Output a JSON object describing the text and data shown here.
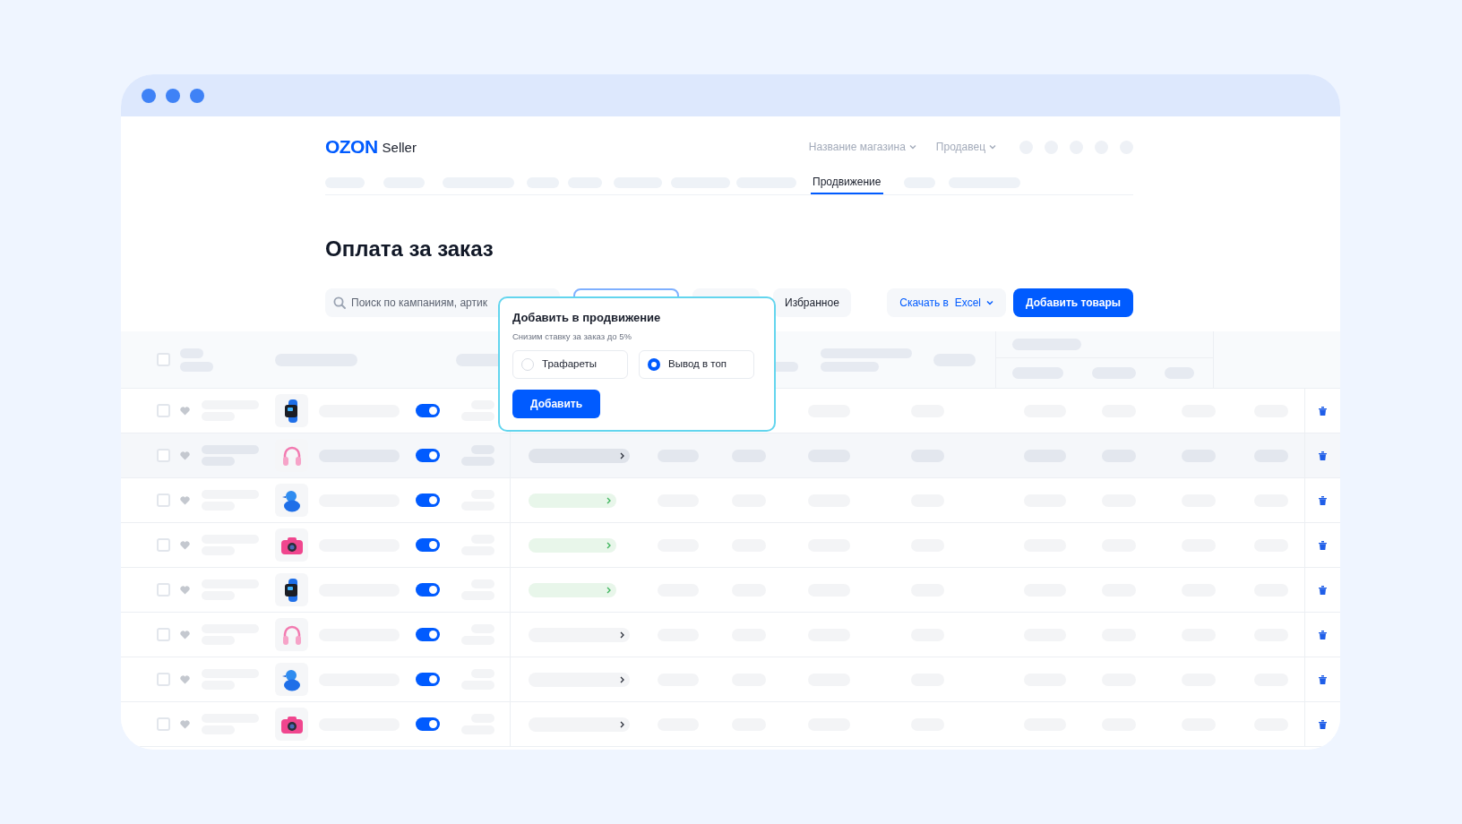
{
  "logo": {
    "brand": "OZON",
    "product": "Seller"
  },
  "header_menus": [
    {
      "label": "Название магазина"
    },
    {
      "label": "Продавец"
    }
  ],
  "nav": [
    {
      "kind": "placeholder",
      "selected": false
    },
    {
      "kind": "placeholder",
      "selected": false
    },
    {
      "kind": "placeholder",
      "selected": false
    },
    {
      "kind": "placeholder",
      "selected": false
    },
    {
      "kind": "placeholder",
      "selected": false
    },
    {
      "kind": "placeholder",
      "selected": false
    },
    {
      "kind": "placeholder",
      "selected": false
    },
    {
      "kind": "placeholder",
      "selected": false
    },
    {
      "kind": "tab",
      "label": "Продвижение",
      "selected": true
    },
    {
      "kind": "placeholder",
      "selected": false
    },
    {
      "kind": "placeholder",
      "selected": false
    }
  ],
  "page_title": "Оплата за заказ",
  "search": {
    "placeholder": "Поиск по кампаниям, артик"
  },
  "toolbar_buttons": [
    {
      "kind": "secondary",
      "label": "Избранное"
    },
    {
      "kind": "link",
      "label": "Скачать в  Excel"
    },
    {
      "kind": "primary",
      "label": "Добавить товары"
    }
  ],
  "popup": {
    "title": "Добавить в продвижение",
    "subtitle": "Снизим ставку за заказ до 5%",
    "options": [
      {
        "label": "Трафареты",
        "selected": false
      },
      {
        "label": "Вывод в топ",
        "selected": true
      }
    ],
    "button": "Добавить"
  },
  "select_all": {
    "checked": false
  },
  "rows": [
    {
      "checked": false,
      "kind": "watch",
      "on": true
    },
    {
      "checked": false,
      "kind": "headphones",
      "on": true,
      "color": "#dfe3ea"
    },
    {
      "checked": false,
      "kind": "duck",
      "on": true,
      "color": "#e8f6ea"
    },
    {
      "checked": false,
      "kind": "camera",
      "on": true,
      "color": "#e8f6ea"
    },
    {
      "checked": false,
      "kind": "watch",
      "on": true,
      "color": "#e8f6ea"
    },
    {
      "checked": false,
      "kind": "headphones",
      "on": true,
      "color": "#f3f4f6"
    },
    {
      "checked": false,
      "kind": "duck",
      "on": true,
      "color": "#f3f4f6"
    },
    {
      "checked": false,
      "kind": "camera",
      "on": true,
      "color": "#f3f4f6"
    }
  ]
}
